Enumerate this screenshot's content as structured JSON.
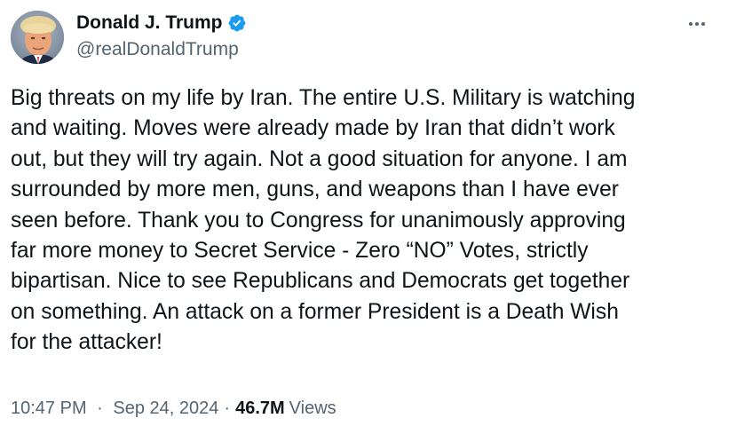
{
  "author": {
    "display_name": "Donald J. Trump",
    "handle": "@realDonaldTrump",
    "verified_icon": "verified-badge-icon",
    "avatar_icon": "profile-photo"
  },
  "menu": {
    "more_icon": "more-horizontal-icon"
  },
  "tweet": {
    "lines": [
      "Big threats on my life by Iran. The entire U.S. Military is watching",
      "and waiting. Moves were already made by Iran that didn’t work",
      "out, but they will try again. Not a good situation for anyone. I am",
      "surrounded by more men, guns, and weapons than I have ever",
      "seen before. Thank you to Congress for unanimously approving",
      "far more money to Secret Service - Zero “NO” Votes, strictly",
      "bipartisan. Nice to see Republicans and Democrats get together",
      "on something. An attack on a former President is a Death Wish",
      "for the attacker!"
    ]
  },
  "meta": {
    "time": "10:47 PM",
    "separator": "·",
    "date": "Sep 24, 2024",
    "views_count": "46.7M",
    "views_label": "Views"
  },
  "colors": {
    "primary_text": "#0f1419",
    "secondary_text": "#536471",
    "verified_blue": "#1d9bf0",
    "background": "#ffffff"
  }
}
